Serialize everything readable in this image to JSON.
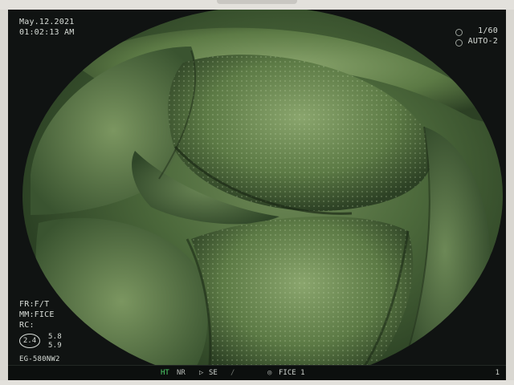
{
  "osd": {
    "date": "May.12.2021",
    "time": "01:02:13  AM",
    "shutter": "1/60",
    "mode": "AUTO-2",
    "fr": "FR:F/T",
    "mm": "MM:FICE",
    "rc": "RC:",
    "enhance_level": "2.4",
    "value_top": "5.8",
    "value_bottom": "5.9",
    "model": "EG-580NW2"
  },
  "status_bar": {
    "ht": "HT",
    "nr": "NR",
    "arrow": "▷",
    "se": "SE",
    "slash": "/",
    "eye": "◎",
    "fice": "FICE 1",
    "page": "1"
  },
  "image": {
    "subject": "endoscopic view of mucosal folds",
    "tint": "#5f7b4a"
  },
  "colors": {
    "osd_text": "#d8ddd8",
    "ht_indicator": "#4fd06a",
    "screen_bg": "#101312",
    "bezel": "#e3e1dc"
  }
}
